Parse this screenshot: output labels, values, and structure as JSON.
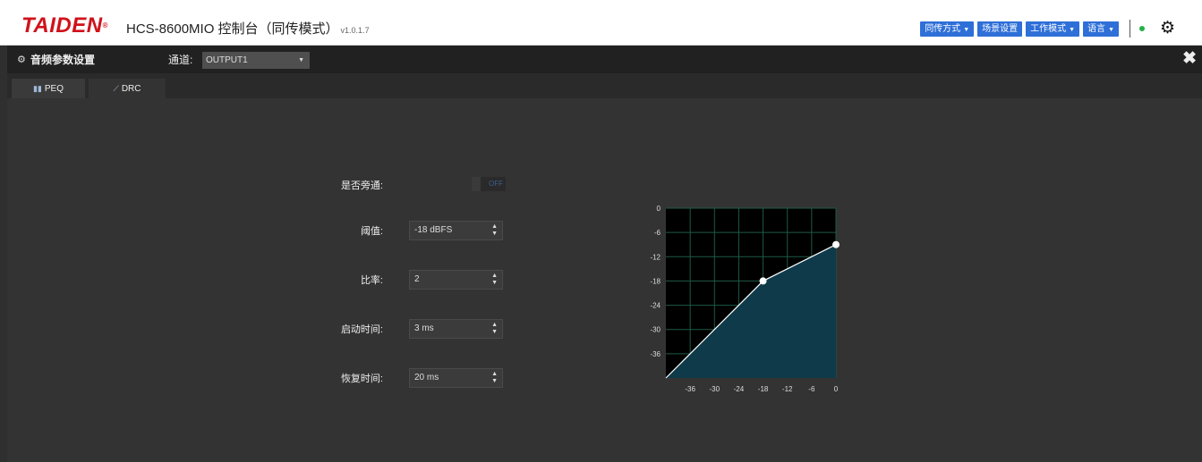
{
  "brand": {
    "logo": "TAIDEN",
    "registered": "®"
  },
  "app": {
    "title": "HCS-8600MIO 控制台（同传模式）",
    "version": "v1.0.1.7"
  },
  "toolbar": {
    "buttons": [
      {
        "label": "同传方式",
        "has_caret": true
      },
      {
        "label": "场景设置",
        "has_caret": false
      },
      {
        "label": "工作模式",
        "has_caret": true
      },
      {
        "label": "语言",
        "has_caret": true
      }
    ],
    "status_color": "#25b04a",
    "accent_color": "#2e6fd8"
  },
  "panel": {
    "title": "音频参数设置",
    "channel_label": "通道:",
    "channel_value": "OUTPUT1",
    "tabs": [
      {
        "label": "PEQ",
        "icon": "bar-chart-icon",
        "active": false
      },
      {
        "label": "DRC",
        "icon": "line-chart-icon",
        "active": true
      }
    ]
  },
  "form": {
    "bypass": {
      "label": "是否旁通:",
      "value": "OFF"
    },
    "threshold": {
      "label": "阈值:",
      "value": "-18 dBFS"
    },
    "ratio": {
      "label": "比率:",
      "value": "2"
    },
    "attack": {
      "label": "启动时间:",
      "value": "3 ms"
    },
    "release": {
      "label": "恢复时间:",
      "value": "20 ms"
    }
  },
  "chart_data": {
    "type": "line",
    "title": "",
    "xlabel": "",
    "ylabel": "",
    "xlim": [
      -42,
      0
    ],
    "ylim": [
      -42,
      0
    ],
    "x_ticks": [
      -36,
      -30,
      -24,
      -18,
      -12,
      -6,
      0
    ],
    "y_ticks": [
      0,
      -6,
      -12,
      -18,
      -24,
      -30,
      -36
    ],
    "grid": true,
    "series": [
      {
        "x": [
          -42,
          -18,
          0
        ],
        "y": [
          -42,
          -18,
          -9
        ]
      }
    ],
    "handles": [
      {
        "x": -18,
        "y": -18
      },
      {
        "x": 0,
        "y": -9
      }
    ],
    "line_color": "#ffffff",
    "fill_color": "#0f3a4a",
    "grid_color": "#1d5a46"
  }
}
